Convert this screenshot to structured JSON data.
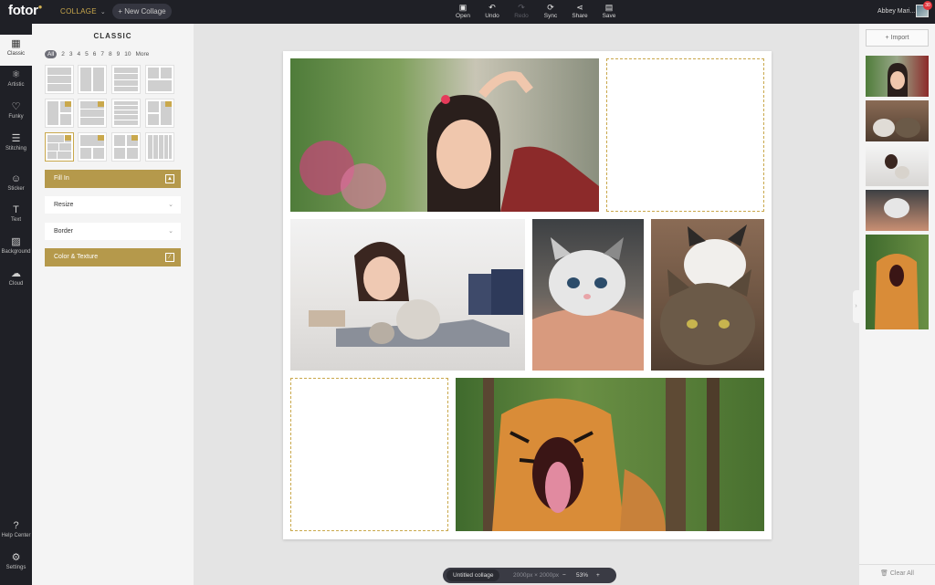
{
  "topbar": {
    "logo": "fotor",
    "mode": "COLLAGE",
    "new_collage": "New Collage",
    "tools": [
      {
        "label": "Open",
        "icon": "open-icon",
        "disabled": false
      },
      {
        "label": "Undo",
        "icon": "undo-icon",
        "disabled": false
      },
      {
        "label": "Redo",
        "icon": "redo-icon",
        "disabled": true
      },
      {
        "label": "Sync",
        "icon": "sync-icon",
        "disabled": false
      },
      {
        "label": "Share",
        "icon": "share-icon",
        "disabled": false
      },
      {
        "label": "Save",
        "icon": "save-icon",
        "disabled": false
      }
    ],
    "user_name": "Abbey Mari...",
    "notification_count": "30"
  },
  "rail": [
    {
      "label": "Classic",
      "icon": "grid-icon",
      "active": true
    },
    {
      "label": "Artistic",
      "icon": "artistic-icon",
      "active": false
    },
    {
      "label": "Funky",
      "icon": "heart-frame-icon",
      "active": false
    },
    {
      "label": "Stitching",
      "icon": "stitching-icon",
      "active": false
    },
    {
      "label": "Sticker",
      "icon": "sticker-icon",
      "active": false
    },
    {
      "label": "Text",
      "icon": "text-icon",
      "active": false
    },
    {
      "label": "Background",
      "icon": "background-icon",
      "active": false
    },
    {
      "label": "Cloud",
      "icon": "cloud-icon",
      "active": false
    },
    {
      "label": "Help Center",
      "icon": "help-icon",
      "active": false
    },
    {
      "label": "Settings",
      "icon": "gear-icon",
      "active": false
    }
  ],
  "panel": {
    "title": "CLASSIC",
    "counts": [
      "All",
      "2",
      "3",
      "4",
      "5",
      "6",
      "7",
      "8",
      "9",
      "10",
      "More"
    ],
    "fill_in": "Fill In",
    "resize": "Resize",
    "border": "Border",
    "color_texture": "Color & Texture"
  },
  "bottombar": {
    "name": "Untitled collage",
    "size": "2000px × 2000px",
    "zoom": "53%",
    "minus": "−",
    "plus": "+"
  },
  "rpanel": {
    "import": "Import",
    "clear_all": "Clear All"
  },
  "colors": {
    "dark": "#1f2026",
    "gold": "#b5994b",
    "accent_gold": "#c9a84c"
  }
}
